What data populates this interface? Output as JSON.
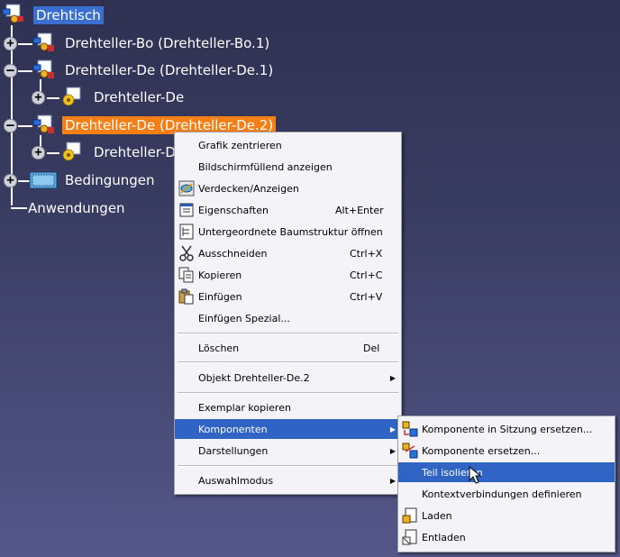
{
  "tree": {
    "root": {
      "label": "Drehtisch"
    },
    "nodes": [
      {
        "label": "Drehteller-Bo (Drehteller-Bo.1)"
      },
      {
        "label": "Drehteller-De (Drehteller-De.1)"
      },
      {
        "label": "Drehteller-De"
      },
      {
        "label": "Drehteller-De (Drehteller-De.2)"
      },
      {
        "label": "Drehteller-D"
      },
      {
        "label": "Bedingungen"
      },
      {
        "label": "Anwendungen"
      }
    ],
    "toggles": {
      "plus": "+",
      "minus": "–"
    }
  },
  "context_menu": {
    "items": [
      {
        "label": "Grafik zentrieren",
        "shortcut": ""
      },
      {
        "label": "Bildschirmfüllend anzeigen",
        "shortcut": ""
      },
      {
        "label": "Verdecken/Anzeigen",
        "shortcut": "",
        "icon": "hide-show-icon"
      },
      {
        "label": "Eigenschaften",
        "shortcut": "Alt+Enter",
        "icon": "properties-icon"
      },
      {
        "label": "Untergeordnete Baumstruktur öffnen",
        "shortcut": "",
        "icon": "subtree-icon"
      },
      {
        "label": "Ausschneiden",
        "shortcut": "Ctrl+X",
        "icon": "scissors-icon"
      },
      {
        "label": "Kopieren",
        "shortcut": "Ctrl+C",
        "icon": "copy-icon"
      },
      {
        "label": "Einfügen",
        "shortcut": "Ctrl+V",
        "icon": "paste-icon"
      },
      {
        "label": "Einfügen Spezial...",
        "shortcut": ""
      },
      {
        "label": "Löschen",
        "shortcut": "Del"
      },
      {
        "label": "Objekt Drehteller-De.2",
        "shortcut": ""
      },
      {
        "label": "Exemplar kopieren",
        "shortcut": ""
      },
      {
        "label": "Komponenten",
        "shortcut": ""
      },
      {
        "label": "Darstellungen",
        "shortcut": ""
      },
      {
        "label": "Auswahlmodus",
        "shortcut": ""
      }
    ]
  },
  "submenu": {
    "items": [
      {
        "label": "Komponente in Sitzung ersetzen...",
        "icon": "replace-in-session-icon"
      },
      {
        "label": "Komponente ersetzen...",
        "icon": "replace-component-icon"
      },
      {
        "label": "Teil isolieren",
        "icon": ""
      },
      {
        "label": "Kontextverbindungen definieren",
        "icon": ""
      },
      {
        "label": "Laden",
        "icon": "load-icon"
      },
      {
        "label": "Entladen",
        "icon": "unload-icon"
      }
    ]
  },
  "colors": {
    "selection_blue": "#3a6fd0",
    "selection_orange": "#f57f17",
    "menu_highlight": "#2f63c4",
    "background_top": "#2f3152",
    "background_bottom": "#545788"
  }
}
